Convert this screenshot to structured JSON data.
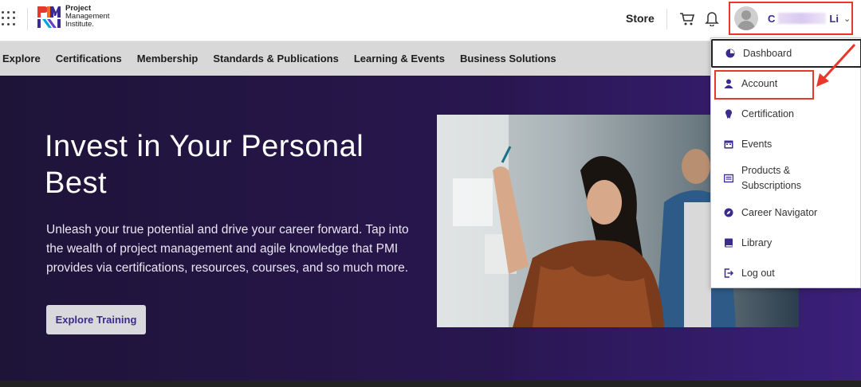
{
  "header": {
    "logo_text": [
      "Project",
      "Management",
      "Institute."
    ],
    "store_label": "Store",
    "user": {
      "first": "C",
      "last": "Li"
    }
  },
  "nav": {
    "items": [
      "Explore",
      "Certifications",
      "Membership",
      "Standards & Publications",
      "Learning & Events",
      "Business Solutions"
    ]
  },
  "hero": {
    "title": "Invest in Your Personal Best",
    "description": "Unleash your true potential and drive your career forward. Tap into the wealth of project management and agile knowledge that PMI provides via certifications, resources, courses, and so much more.",
    "button_label": "Explore Training"
  },
  "dropdown": {
    "items": [
      {
        "label": "Dashboard",
        "icon": "dashboard-icon"
      },
      {
        "label": "Account",
        "icon": "user-icon"
      },
      {
        "label": "Certification",
        "icon": "certification-icon"
      },
      {
        "label": "Events",
        "icon": "calendar-icon"
      },
      {
        "label": "Products & Subscriptions",
        "icon": "products-icon"
      },
      {
        "label": "Career Navigator",
        "icon": "compass-icon"
      },
      {
        "label": "Library",
        "icon": "book-icon"
      },
      {
        "label": "Log out",
        "icon": "logout-icon"
      }
    ]
  },
  "colors": {
    "brand_purple": "#3b2a8f",
    "highlight_red": "#e8372b",
    "hero_bg": "#28164e",
    "nav_bg": "#d8d8d8"
  }
}
